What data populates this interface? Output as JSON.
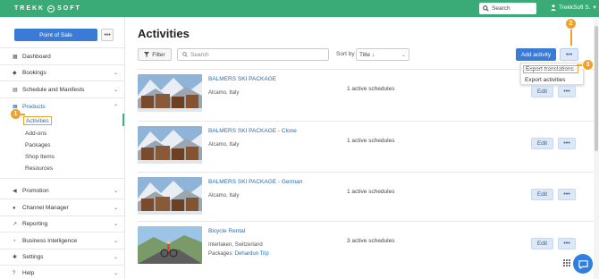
{
  "header": {
    "logo_text": "TREKK SOFT",
    "search_placeholder": "Search",
    "user_label": "TrekkSoft S.",
    "accent_color": "#3aaa76"
  },
  "sidebar": {
    "pos_label": "Point of Sale",
    "more_label": "•••",
    "items": [
      {
        "label": "Dashboard",
        "icon": "dashboard-icon"
      },
      {
        "label": "Bookings",
        "icon": "tag-icon"
      },
      {
        "label": "Schedule and Manifests",
        "icon": "calendar-icon"
      },
      {
        "label": "Products",
        "icon": "grid-icon"
      },
      {
        "label": "Promotion",
        "icon": "megaphone-icon"
      },
      {
        "label": "Channel Manager",
        "icon": "globe-icon"
      },
      {
        "label": "Reporting",
        "icon": "chart-icon"
      },
      {
        "label": "Business Intelligence",
        "icon": "pie-icon"
      },
      {
        "label": "Settings",
        "icon": "gear-icon"
      },
      {
        "label": "Help",
        "icon": "help-icon"
      }
    ],
    "products_sub": [
      "Activities",
      "Add-ons",
      "Packages",
      "Shop Items",
      "Resources"
    ]
  },
  "main": {
    "title": "Activities",
    "filter_label": "Filter",
    "search_placeholder": "Search",
    "sort_by_label": "Sort by",
    "sort_value": "Title ↓",
    "add_label": "Add activity",
    "more_label": "•••",
    "dropdown": [
      "Export translations",
      "Export activities"
    ],
    "rows": [
      {
        "title": "BALMERS SKI PACKAGE",
        "location": "Alcamo, Italy",
        "schedules": "1 active schedules",
        "edit": "Edit",
        "more": "•••"
      },
      {
        "title": "BALMERS SKI PACKAGE - Clone",
        "location": "Alcamo, Italy",
        "schedules": "1 active schedules",
        "edit": "Edit",
        "more": "•••"
      },
      {
        "title": "BALMERS SKI PACKAGE - German",
        "location": "Alcamo, Italy",
        "schedules": "1 active schedules",
        "edit": "Edit",
        "more": "•••"
      },
      {
        "title": "Bicycle Rental",
        "location": "Interlaken, Switzerland",
        "packages_label": "Packages:",
        "packages_link": "Dehardun Trip",
        "schedules": "3 active schedules",
        "edit": "Edit",
        "more": "•••"
      }
    ]
  },
  "callouts": [
    "1",
    "2",
    "3"
  ]
}
